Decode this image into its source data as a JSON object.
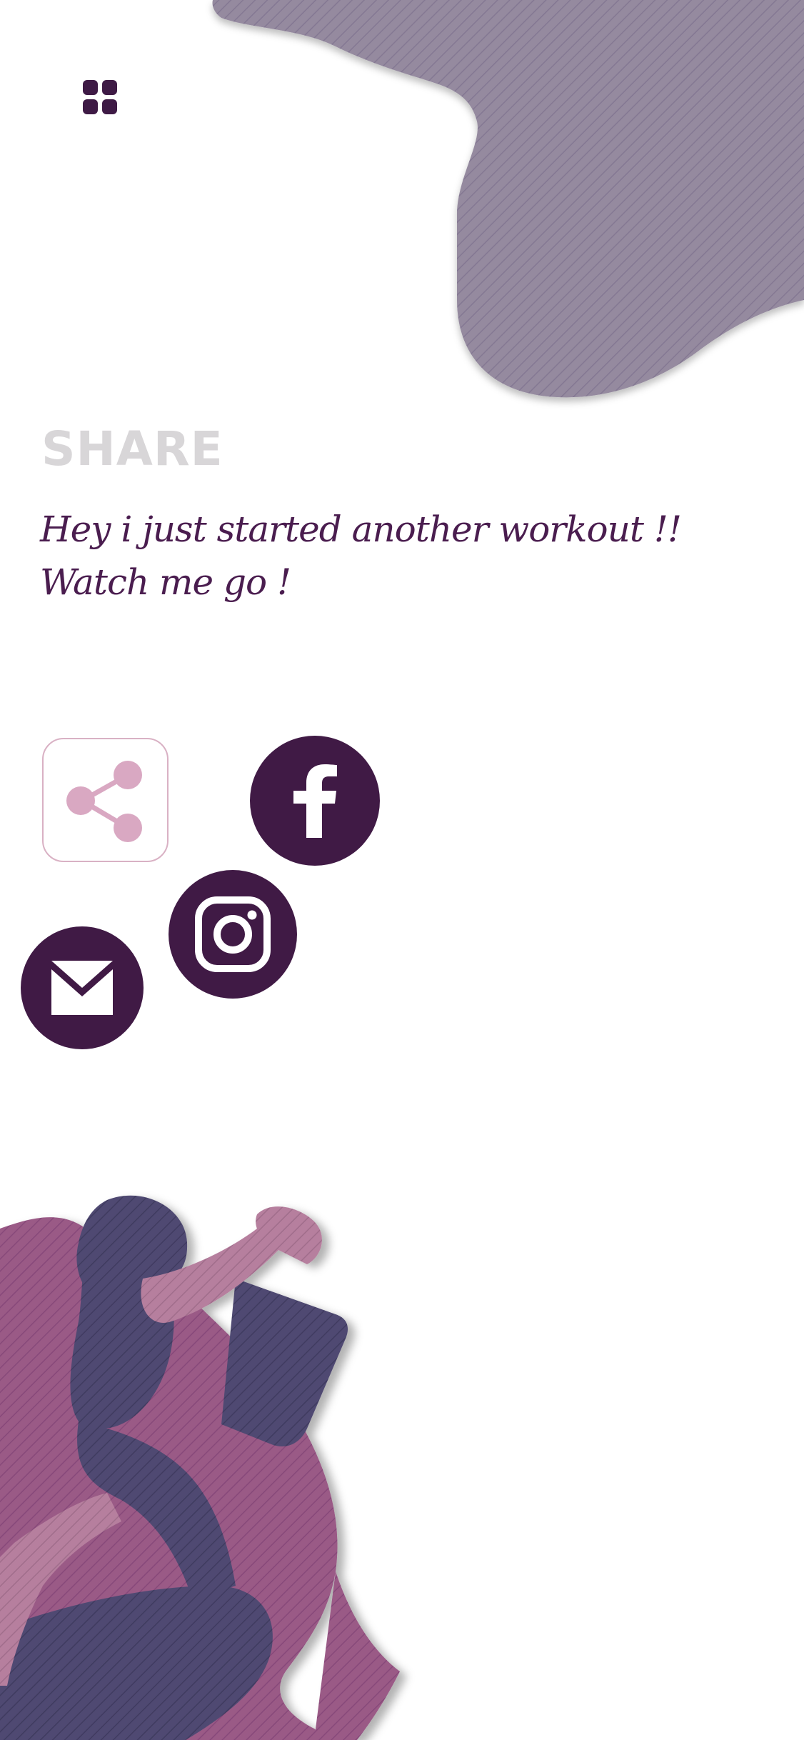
{
  "header": {
    "menu_icon": "grid-menu-icon"
  },
  "share": {
    "title": "SHARE",
    "message_line1": "Hey i just started another workout !!",
    "message_line2": "Watch me go !"
  },
  "buttons": {
    "share_icon": "share-icon",
    "facebook_icon": "facebook-icon",
    "instagram_icon": "instagram-icon",
    "mail_icon": "mail-icon"
  },
  "colors": {
    "primary": "#401a45",
    "accent_pink": "#d9a8c2",
    "blob": "#958a9f",
    "title_gray": "#d8d6d8"
  }
}
